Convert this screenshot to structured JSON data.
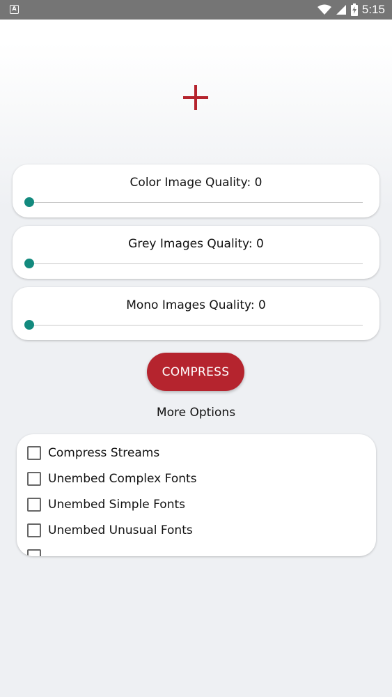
{
  "status_bar": {
    "app_icon_letter": "A",
    "time": "5:15"
  },
  "sliders": [
    {
      "label": "Color Image Quality: 0",
      "value": 0,
      "max": 100
    },
    {
      "label": "Grey Images Quality: 0",
      "value": 0,
      "max": 100
    },
    {
      "label": "Mono Images Quality: 0",
      "value": 0,
      "max": 100
    }
  ],
  "compress_label": "COMPRESS",
  "more_options_label": "More Options",
  "options": [
    {
      "label": "Compress Streams",
      "checked": false
    },
    {
      "label": "Unembed Complex Fonts",
      "checked": false
    },
    {
      "label": "Unembed Simple Fonts",
      "checked": false
    },
    {
      "label": "Unembed Unusual Fonts",
      "checked": false
    }
  ],
  "colors": {
    "accent_red": "#b5242e",
    "slider_teal": "#138a7e",
    "status_bar": "#757575"
  }
}
